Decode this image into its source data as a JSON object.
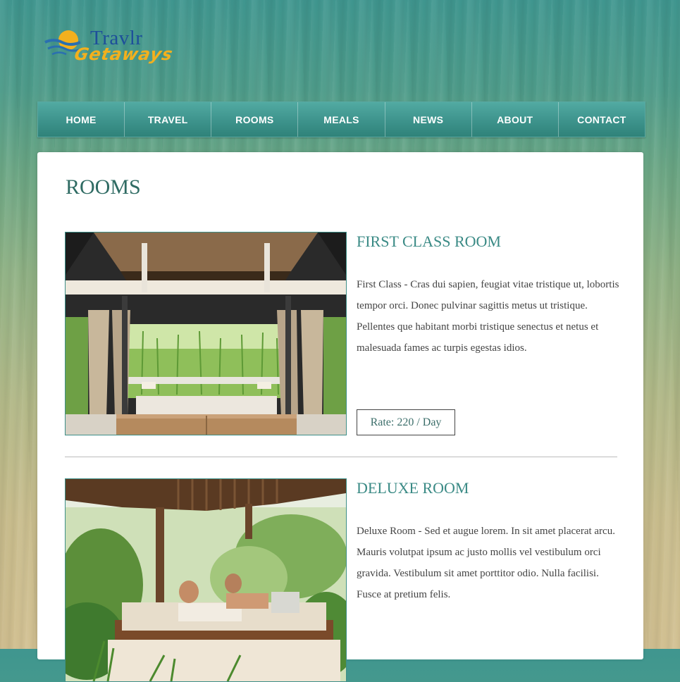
{
  "logo": {
    "word1": "Travlr",
    "word2": "Getaways"
  },
  "nav": {
    "items": [
      {
        "label": "HOME"
      },
      {
        "label": "TRAVEL"
      },
      {
        "label": "ROOMS"
      },
      {
        "label": "MEALS"
      },
      {
        "label": "NEWS"
      },
      {
        "label": "ABOUT"
      },
      {
        "label": "CONTACT"
      }
    ]
  },
  "page": {
    "title": "ROOMS"
  },
  "rooms": [
    {
      "title": "FIRST CLASS ROOM",
      "description": "First Class - Cras dui sapien, feugiat vitae tristique ut, lobortis tempor orci. Donec pulvinar sagittis metus ut tristique. Pellentes que habitant morbi tristique senectus et netus et malesuada fames ac turpis egestas idios.",
      "rate": "Rate: 220 / Day"
    },
    {
      "title": "DELUXE ROOM",
      "description": "Deluxe Room - Sed et augue lorem. In sit amet placerat arcu. Mauris volutpat ipsum ac justo mollis vel vestibulum orci gravida. Vestibulum sit amet porttitor odio. Nulla facilisi. Fusce at pretium felis."
    }
  ],
  "colors": {
    "nav_bg": "#3f958e",
    "title_teal": "#2f6b63",
    "room_title_teal": "#3a8a85",
    "logo_blue": "#1d4f9a",
    "logo_gold": "#f2b01e"
  }
}
